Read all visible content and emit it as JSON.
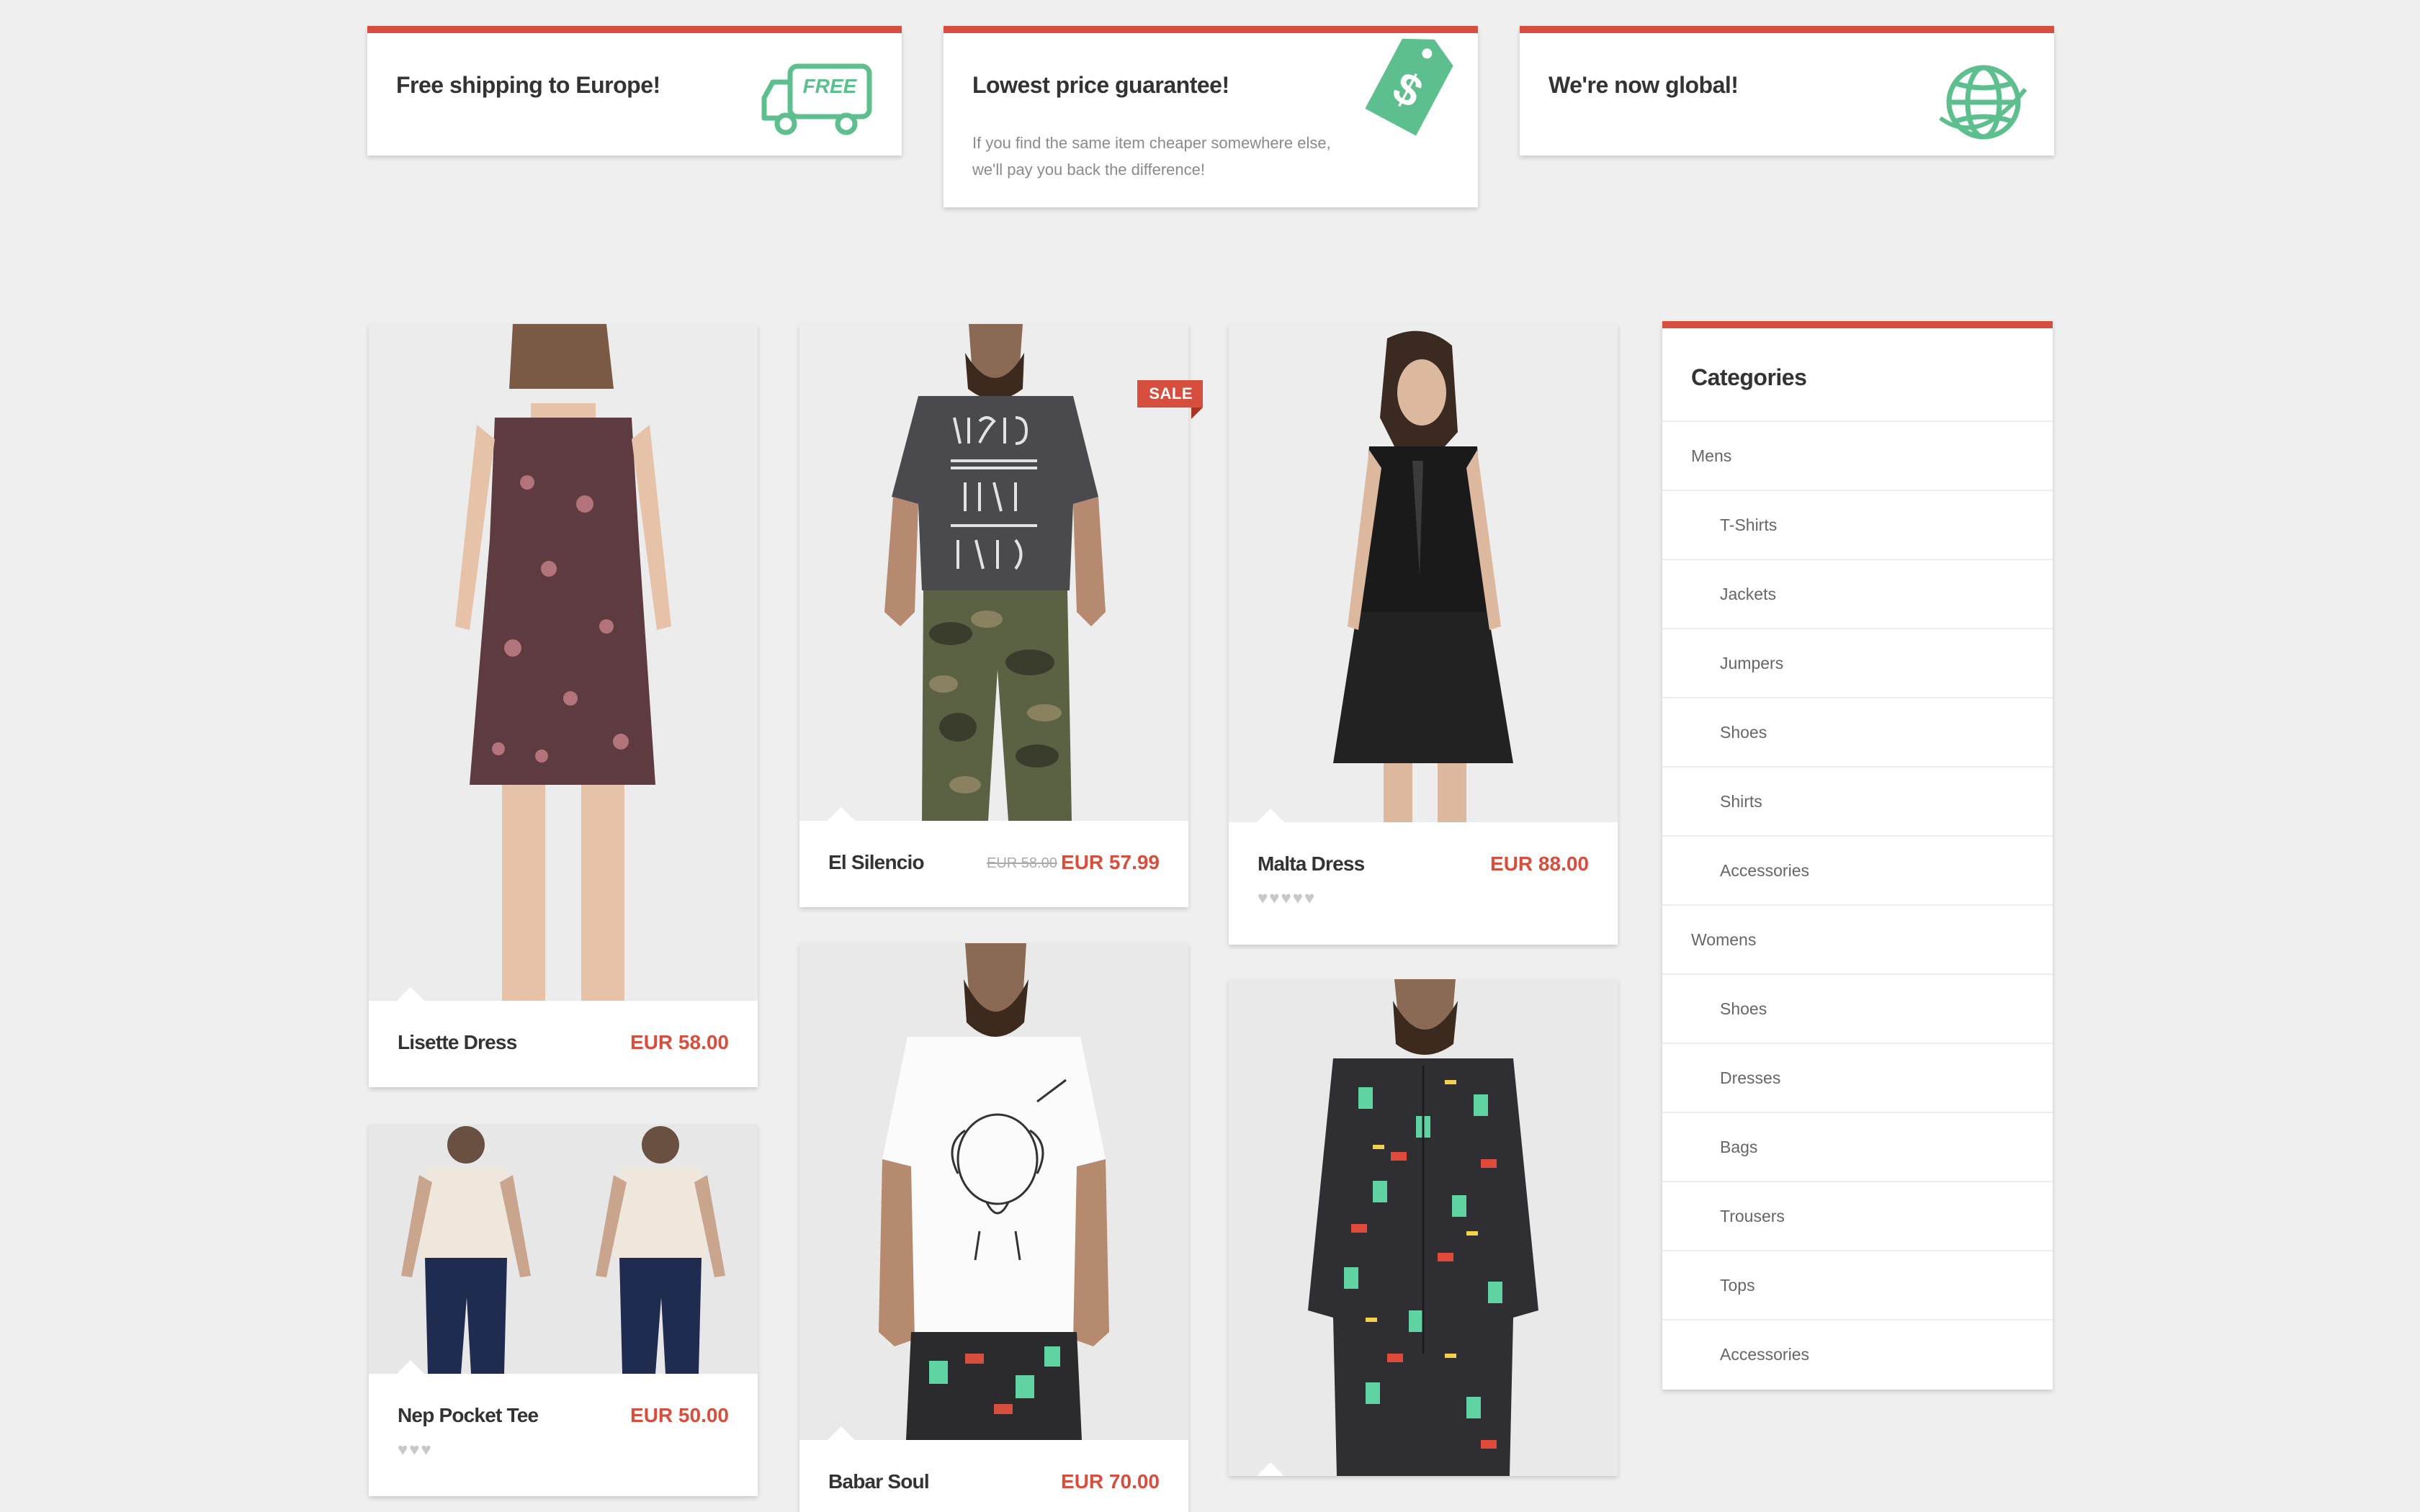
{
  "features": [
    {
      "title": "Free shipping to Europe!",
      "icon": "truck-icon",
      "badge": "FREE"
    },
    {
      "title": "Lowest price guarantee!",
      "desc": "If you find the same item cheaper somewhere else, we'll pay you back the difference!",
      "icon": "price-tag-icon"
    },
    {
      "title": "We're now global!",
      "icon": "globe-icon"
    }
  ],
  "products": [
    {
      "name": "Lisette Dress",
      "price": "EUR 58.00"
    },
    {
      "name": "Nep Pocket Tee",
      "price": "EUR 50.00",
      "rating_stars": 3
    },
    {
      "name": "El Silencio",
      "price": "EUR 57.99",
      "old_price": "EUR 58.00",
      "badge": "SALE"
    },
    {
      "name": "Babar Soul",
      "price": "EUR 70.00"
    },
    {
      "name": "Malta Dress",
      "price": "EUR 88.00",
      "rating_stars": 5
    },
    {
      "name": "",
      "price": ""
    }
  ],
  "categories": {
    "title": "Categories",
    "items": [
      {
        "label": "Mens",
        "level": 0
      },
      {
        "label": "T-Shirts",
        "level": 1
      },
      {
        "label": "Jackets",
        "level": 1
      },
      {
        "label": "Jumpers",
        "level": 1
      },
      {
        "label": "Shoes",
        "level": 1
      },
      {
        "label": "Shirts",
        "level": 1
      },
      {
        "label": "Accessories",
        "level": 1
      },
      {
        "label": "Womens",
        "level": 0
      },
      {
        "label": "Shoes",
        "level": 1
      },
      {
        "label": "Dresses",
        "level": 1
      },
      {
        "label": "Bags",
        "level": 1
      },
      {
        "label": "Trousers",
        "level": 1
      },
      {
        "label": "Tops",
        "level": 1
      },
      {
        "label": "Accessories",
        "level": 1
      }
    ]
  },
  "colors": {
    "accent": "#d64f3e",
    "icon_green": "#5cbf8d",
    "background": "#efefef"
  }
}
